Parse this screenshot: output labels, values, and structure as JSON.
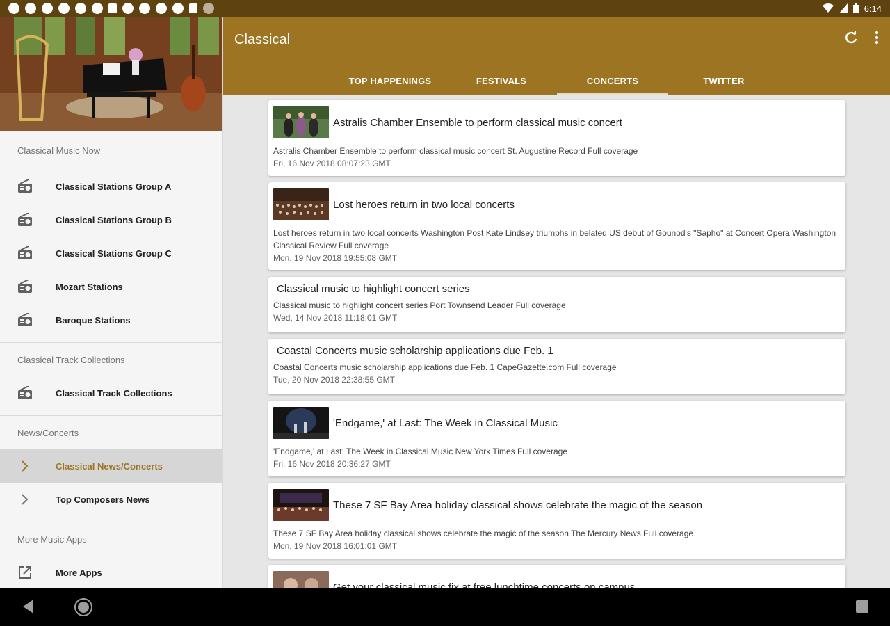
{
  "status_bar": {
    "time": "6:14"
  },
  "app": {
    "title": "Classical"
  },
  "toolbar": {
    "refresh_icon": "refresh-icon",
    "menu_icon": "overflow-menu-icon"
  },
  "tabs": [
    {
      "label": "TOP HAPPENINGS"
    },
    {
      "label": "FESTIVALS"
    },
    {
      "label": "CONCERTS"
    },
    {
      "label": "TWITTER"
    }
  ],
  "drawer": {
    "sections": [
      {
        "title": "Classical Music Now",
        "items": [
          {
            "label": "Classical Stations Group A",
            "icon": "radio-icon"
          },
          {
            "label": "Classical Stations Group B",
            "icon": "radio-icon"
          },
          {
            "label": "Classical Stations Group C",
            "icon": "radio-icon"
          },
          {
            "label": "Mozart Stations",
            "icon": "radio-icon"
          },
          {
            "label": "Baroque Stations",
            "icon": "radio-icon"
          }
        ]
      },
      {
        "title": "Classical Track Collections",
        "items": [
          {
            "label": "Classical Track Collections",
            "icon": "radio-icon"
          }
        ]
      },
      {
        "title": "News/Concerts",
        "items": [
          {
            "label": "Classical News/Concerts",
            "icon": "chevron-right-icon"
          },
          {
            "label": "Top Composers News",
            "icon": "chevron-right-icon"
          }
        ]
      },
      {
        "title": "More Music Apps",
        "items": [
          {
            "label": "More Apps",
            "icon": "open-external-icon"
          }
        ]
      }
    ]
  },
  "cards": [
    {
      "title": "Astralis Chamber Ensemble to perform classical music concert",
      "desc": "Astralis Chamber Ensemble to perform classical music concert  St. Augustine Record  Full coverage",
      "date": "Fri, 16 Nov 2018 08:07:23 GMT"
    },
    {
      "title": "Lost heroes return in two local concerts",
      "desc": "Lost heroes return in two local concerts  Washington Post  Kate Lindsey triumphs in belated US debut of Gounod's \"Sapho\" at Concert Opera  Washington Classical Review  Full coverage",
      "date": "Mon, 19 Nov 2018 19:55:08 GMT"
    },
    {
      "title": "Classical music to highlight concert series",
      "desc": "Classical music to highlight concert series  Port Townsend Leader  Full coverage",
      "date": "Wed, 14 Nov 2018 11:18:01 GMT"
    },
    {
      "title": "Coastal Concerts music scholarship applications due Feb. 1",
      "desc": "Coastal Concerts music scholarship applications due Feb. 1  CapeGazette.com  Full coverage",
      "date": "Tue, 20 Nov 2018 22:38:55 GMT"
    },
    {
      "title": "'Endgame,' at Last: The Week in Classical Music",
      "desc": "'Endgame,' at Last: The Week in Classical Music  New York Times  Full coverage",
      "date": "Fri, 16 Nov 2018 20:36:27 GMT"
    },
    {
      "title": "These 7 SF Bay Area holiday classical shows celebrate the magic of the season",
      "desc": "These 7 SF Bay Area holiday classical shows celebrate the magic of the season  The Mercury News  Full coverage",
      "date": "Mon, 19 Nov 2018 16:01:01 GMT"
    },
    {
      "title": "Get your classical music fix at free lunchtime concerts on campus"
    }
  ],
  "colors": {
    "primary": "#9c7422",
    "status_bar": "#5e4310",
    "accent_text": "#9c7422"
  }
}
